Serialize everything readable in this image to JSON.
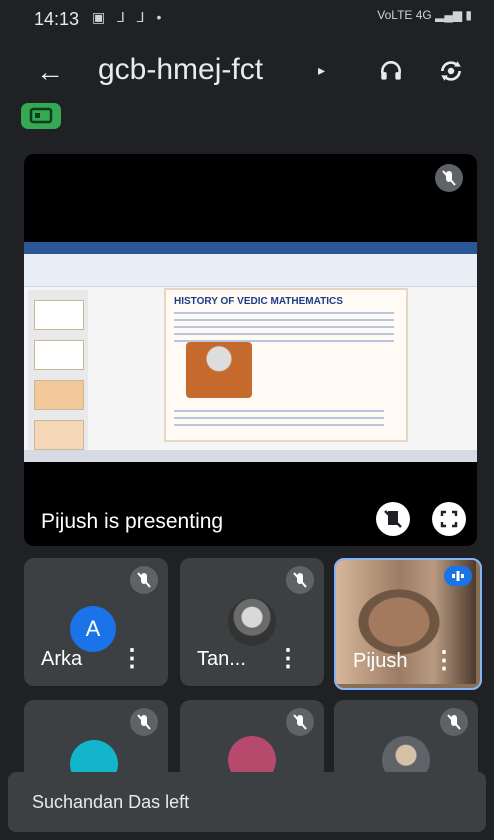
{
  "status_bar": {
    "time": "14:13",
    "left_icons": "▣ ⅃ ⅃ •",
    "right_icons": "VoLTE 4G ▂▄▆ ▮"
  },
  "header": {
    "title": "gcb-hmej-fct",
    "caret": "▸"
  },
  "stage": {
    "presenting_text": "Pijush is presenting",
    "slide_title": "HISTORY OF VEDIC MATHEMATICS"
  },
  "participants": [
    {
      "name": "Arka",
      "avatar_letter": "A",
      "muted": true
    },
    {
      "name": "Tan...",
      "muted": true
    },
    {
      "name": "Pijush",
      "speaking": true
    },
    {
      "name": "",
      "avatar_letter": "",
      "muted": true
    },
    {
      "name": "",
      "muted": true
    },
    {
      "name": "",
      "muted": true
    }
  ],
  "toast": {
    "text": "Suchandan Das left"
  },
  "icons": [
    "back-arrow-icon",
    "headphone-icon",
    "camera-switch-icon",
    "mic-off-icon",
    "stop-presenting-icon",
    "fullscreen-icon",
    "more-vert-icon",
    "speaker-dots-icon",
    "cast-badge-icon"
  ],
  "colors": {
    "accent": "#1a73e8",
    "green": "#34a853",
    "teal": "#12b5cb"
  }
}
